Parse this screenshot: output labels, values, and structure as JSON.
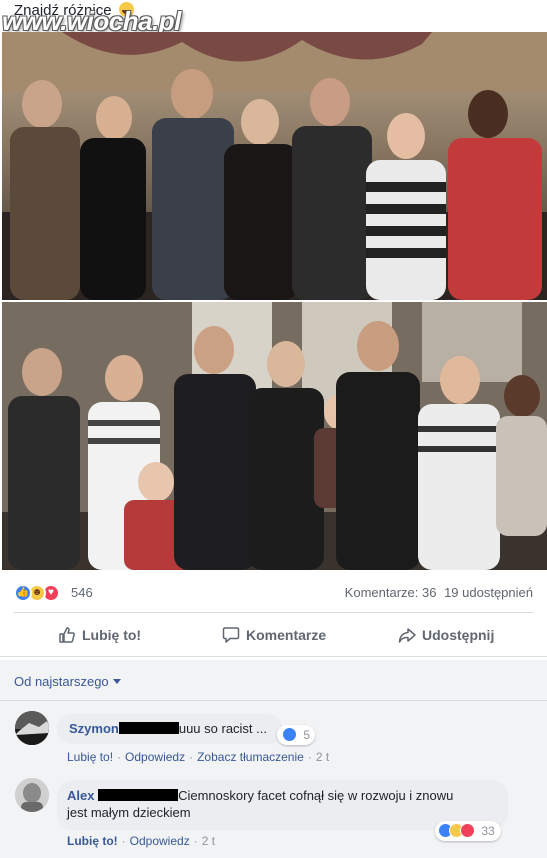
{
  "post": {
    "caption": "Znajdź różnice",
    "caption_emoji": "grinning-squinting-face",
    "watermark": "www.wiocha.pl",
    "photos": [
      "family-photo-before",
      "family-photo-after"
    ]
  },
  "reactions": {
    "types": [
      "like",
      "haha",
      "love"
    ],
    "count": "546",
    "comments_label": "Komentarze: 36",
    "shares_label": "19 udostępnień"
  },
  "actions": {
    "like": "Lubię to!",
    "comment": "Komentarze",
    "share": "Udostępnij"
  },
  "comments_section": {
    "sort_label": "Od najstarszego",
    "items": [
      {
        "author": "Szymon",
        "text": "uuu so racist ...",
        "reaction_count": "5",
        "reaction_types": [
          "like"
        ],
        "like_label": "Lubię to!",
        "reply_label": "Odpowiedz",
        "translate_label": "Zobacz tłumaczenie",
        "time": "2 t"
      },
      {
        "author": "Alex",
        "text_line1": "Ciemnoskory facet cofnął się w rozwoju i znowu",
        "text_line2": "jest małym dzieckiem",
        "reaction_count": "33",
        "reaction_types": [
          "like",
          "haha",
          "love"
        ],
        "like_label": "Lubię to!",
        "reply_label": "Odpowiedz",
        "time": "2 t"
      }
    ]
  },
  "colors": {
    "link_blue": "#385898",
    "like_blue": "#3b82f6",
    "haha_yellow": "#f7c948",
    "love_red": "#f0405a",
    "muted_gray": "#606770",
    "comment_bubble": "#ebedf0",
    "redaction_bar": "#000000"
  }
}
